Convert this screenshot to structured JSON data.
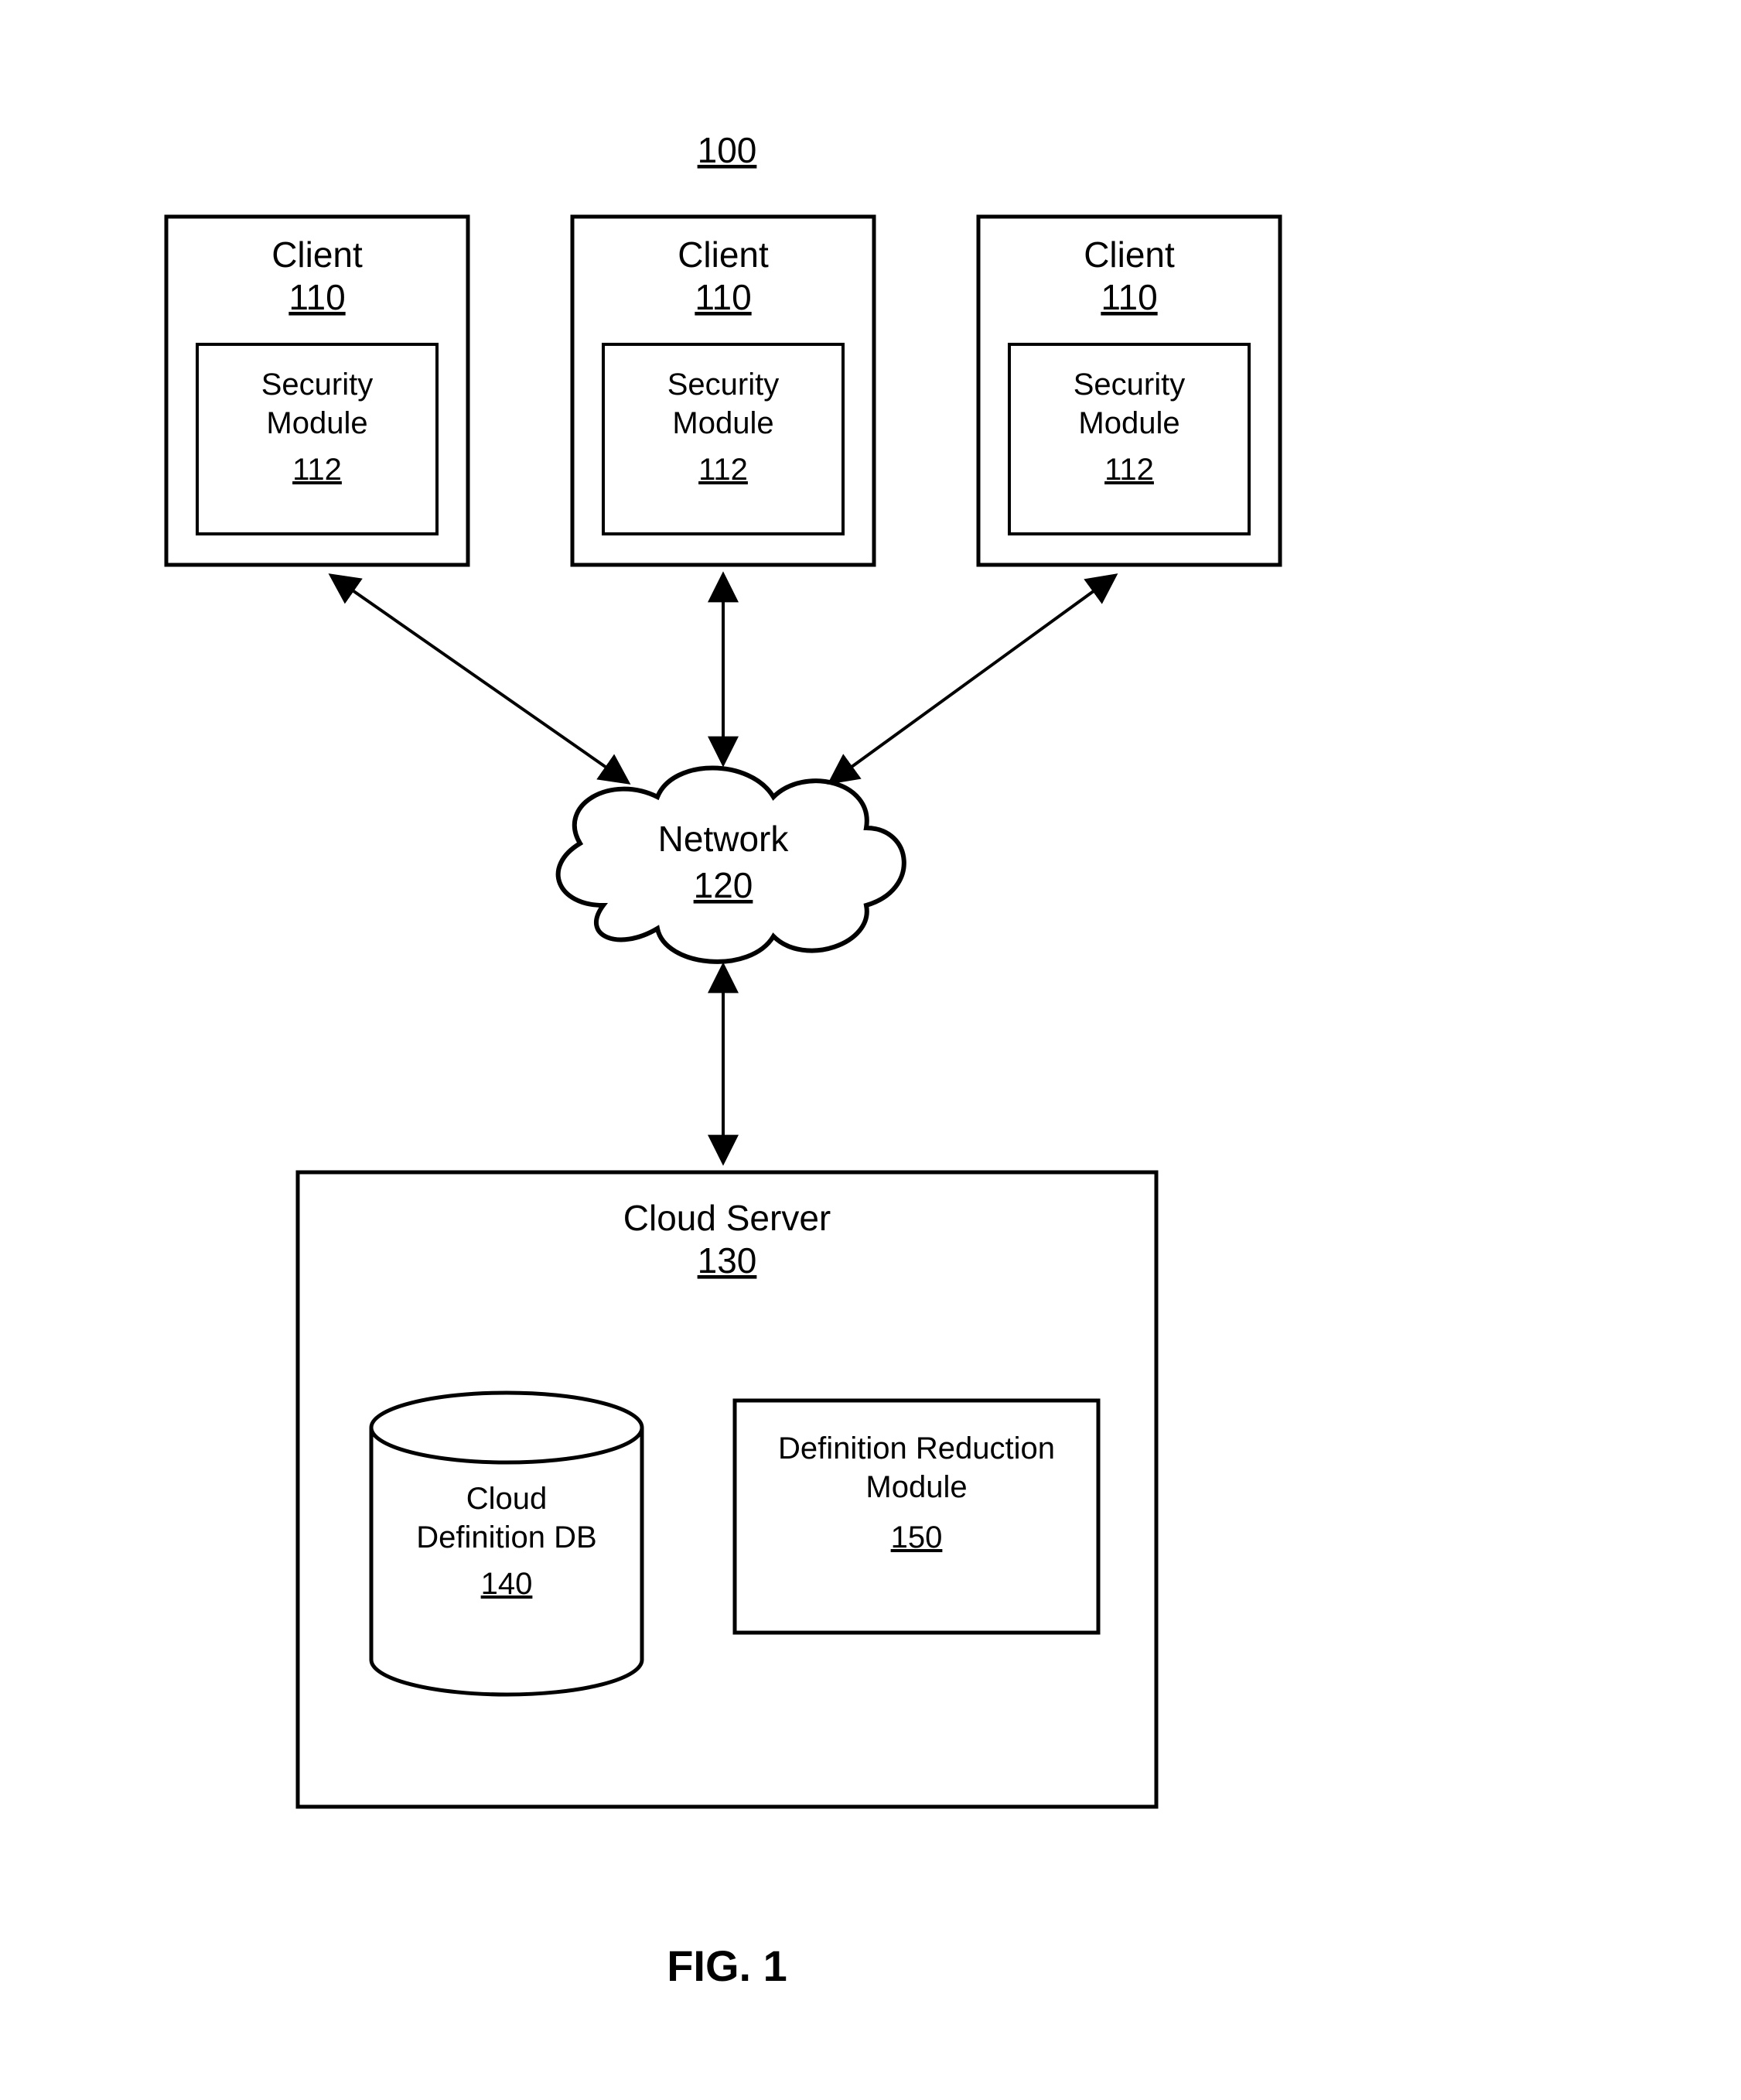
{
  "figure": {
    "ref": "100",
    "caption": "FIG. 1"
  },
  "clients": [
    {
      "title": "Client",
      "ref": "110",
      "module": {
        "title": "Security Module",
        "ref": "112"
      }
    },
    {
      "title": "Client",
      "ref": "110",
      "module": {
        "title": "Security Module",
        "ref": "112"
      }
    },
    {
      "title": "Client",
      "ref": "110",
      "module": {
        "title": "Security Module",
        "ref": "112"
      }
    }
  ],
  "network": {
    "title": "Network",
    "ref": "120"
  },
  "server": {
    "title": "Cloud Server",
    "ref": "130",
    "db": {
      "line1": "Cloud",
      "line2": "Definition DB",
      "ref": "140"
    },
    "module": {
      "line1": "Definition Reduction",
      "line2": "Module",
      "ref": "150"
    }
  }
}
